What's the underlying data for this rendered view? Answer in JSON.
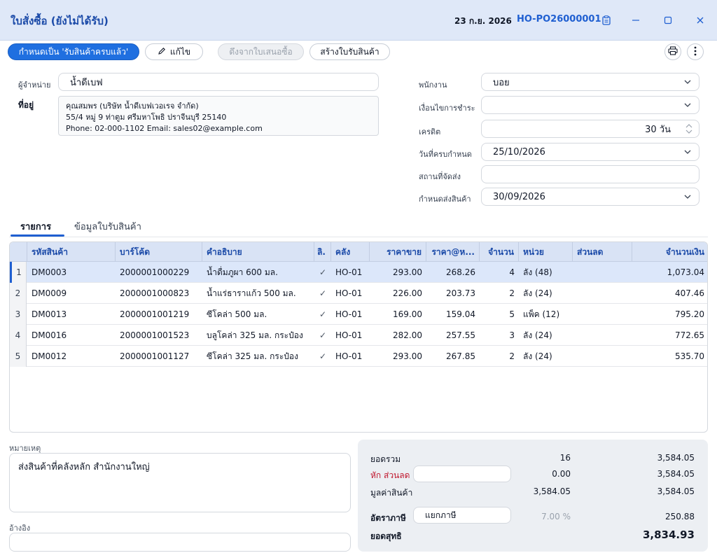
{
  "window": {
    "title": "ใบสั่งซื้อ (ยังไม่ได้รับ)",
    "date": "23 ก.ย. 2026",
    "po_number": "HO-PO26000001"
  },
  "toolbar": {
    "mark_received_label": "กำหนดเป็น 'รับสินค้าครบแล้ว'",
    "edit_label": "แก้ไข",
    "pull_from_quote_label": "ดึงจากใบเสนอซื้อ",
    "create_receipt_label": "สร้างใบรับสินค้า"
  },
  "form": {
    "supplier_label": "ผู้จำหน่าย",
    "supplier_value": "น้ำดีเบฟ",
    "address_label": "ที่อยู่",
    "address_lines": [
      "คุณสมพร (บริษัท น้ำดีเบฟเวอเรจ จำกัด)",
      "55/4 หมู่ 9  ท่าตูม ศรีมหาโพธิ ปราจีนบุรี 25140",
      "Phone: 02-000-1102 Email: sales02@example.com"
    ],
    "employee_label": "พนักงาน",
    "employee_value": "บอย",
    "payment_terms_label": "เงื่อนไขการชำระ",
    "payment_terms_value": "",
    "credit_label": "เครดิต",
    "credit_value": "30 วัน",
    "due_date_label": "วันที่ครบกำหนด",
    "due_date_value": "25/10/2026",
    "ship_to_label": "สถานที่จัดส่ง",
    "ship_to_value": "",
    "delivery_date_label": "กำหนดส่งสินค้า",
    "delivery_date_value": "30/09/2026"
  },
  "tabs": [
    {
      "label": "รายการ",
      "active": true
    },
    {
      "label": "ข้อมูลใบรับสินค้า",
      "active": false
    }
  ],
  "table": {
    "headers": {
      "code": "รหัสสินค้า",
      "barcode": "บาร์โค้ด",
      "description": "คำอธิบาย",
      "vat": "ลิ.",
      "warehouse": "คลัง",
      "sell_price": "ราคาขาย",
      "unit_price": "ราคา@ห...",
      "qty": "จำนวน",
      "unit": "หน่วย",
      "discount": "ส่วนลด",
      "amount": "จำนวนเงิน"
    },
    "rows": [
      {
        "n": "1",
        "code": "DM0003",
        "barcode": "2000001000229",
        "description": "น้ำดื่มภูผา 600 มล.",
        "vat": "✓",
        "warehouse": "HO-01",
        "sell_price": "293.00",
        "unit_price": "268.26",
        "qty": "4",
        "unit": "ลัง (48)",
        "discount": "",
        "amount": "1,073.04"
      },
      {
        "n": "2",
        "code": "DM0009",
        "barcode": "2000001000823",
        "description": "น้ำแร่ธาราแก้ว 500 มล.",
        "vat": "✓",
        "warehouse": "HO-01",
        "sell_price": "226.00",
        "unit_price": "203.73",
        "qty": "2",
        "unit": "ลัง (24)",
        "discount": "",
        "amount": "407.46"
      },
      {
        "n": "3",
        "code": "DM0013",
        "barcode": "2000001001219",
        "description": "ซีโคล่า 500 มล.",
        "vat": "✓",
        "warehouse": "HO-01",
        "sell_price": "169.00",
        "unit_price": "159.04",
        "qty": "5",
        "unit": "แพ็ค (12)",
        "discount": "",
        "amount": "795.20"
      },
      {
        "n": "4",
        "code": "DM0016",
        "barcode": "2000001001523",
        "description": "บลูโคล่า 325 มล. กระป๋อง",
        "vat": "✓",
        "warehouse": "HO-01",
        "sell_price": "282.00",
        "unit_price": "257.55",
        "qty": "3",
        "unit": "ลัง (24)",
        "discount": "",
        "amount": "772.65"
      },
      {
        "n": "5",
        "code": "DM0012",
        "barcode": "2000001001127",
        "description": "ซีโคล่า 325 มล. กระป๋อง",
        "vat": "✓",
        "warehouse": "HO-01",
        "sell_price": "293.00",
        "unit_price": "267.85",
        "qty": "2",
        "unit": "ลัง (24)",
        "discount": "",
        "amount": "535.70"
      }
    ]
  },
  "notes": {
    "remark_label": "หมายเหตุ",
    "remark_value": "ส่งสินค้าที่คลังหลัก สำนักงานใหญ่",
    "reference_label": "อ้างอิง",
    "reference_value": ""
  },
  "summary": {
    "total_label": "ยอดรวม",
    "total_qty": "16",
    "total_amount": "3,584.05",
    "discount_label": "หัก ส่วนลด",
    "discount_input": "",
    "discount_value": "0.00",
    "discount_amount": "3,584.05",
    "goods_value_label": "มูลค่าสินค้า",
    "goods_value": "3,584.05",
    "goods_value_amount": "3,584.05",
    "tax_rate_label": "อัตราภาษี",
    "tax_mode": "แยกภาษี",
    "tax_percent": "7.00 %",
    "tax_amount": "250.88",
    "net_label": "ยอดสุทธิ",
    "net_amount": "3,834.93"
  },
  "colors": {
    "accent": "#1f5fd1",
    "header_bg": "#dfe8f8",
    "discount_red": "#c0172e"
  }
}
